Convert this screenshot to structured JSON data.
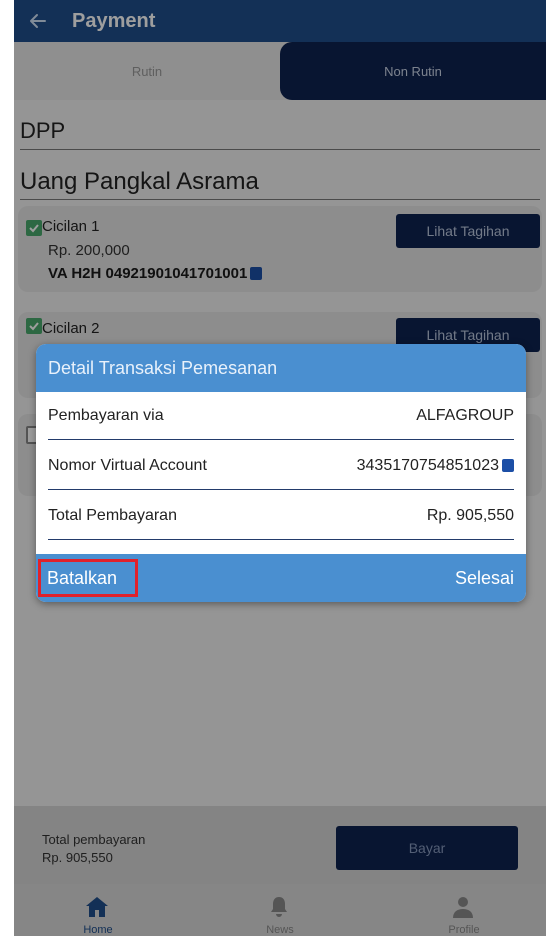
{
  "header": {
    "title": "Payment",
    "back_icon": "arrow-left-icon"
  },
  "tabs": [
    {
      "label": "Rutin",
      "active": false
    },
    {
      "label": "Non Rutin",
      "active": true
    }
  ],
  "sections": {
    "dpp": "DPP",
    "uang_pangkal": "Uang Pangkal Asrama"
  },
  "items": [
    {
      "label": "Cicilan 1",
      "amount": "Rp. 200,000",
      "va": "VA H2H 04921901041701001",
      "button": "Lihat Tagihan",
      "checked": true
    },
    {
      "label": "Cicilan 2",
      "button": "Lihat Tagihan",
      "checked": true
    }
  ],
  "dialog": {
    "title": "Detail Transaksi Pemesanan",
    "rows": [
      {
        "label": "Pembayaran via",
        "value": "ALFAGROUP"
      },
      {
        "label": "Nomor Virtual Account",
        "value": "3435170754851023"
      },
      {
        "label": "Total Pembayaran",
        "value": "Rp. 905,550"
      }
    ],
    "cancel": "Batalkan",
    "done": "Selesai"
  },
  "footer": {
    "total_label": "Total pembayaran",
    "total_value": "Rp. 905,550",
    "pay": "Bayar"
  },
  "nav": [
    {
      "label": "Home",
      "icon": "home-icon"
    },
    {
      "label": "News",
      "icon": "bell-icon"
    },
    {
      "label": "Profile",
      "icon": "user-icon"
    }
  ],
  "colors": {
    "primary": "#1f4e8c",
    "navy": "#0e2250",
    "dialog": "#4a8fd0",
    "highlight": "#e0212b",
    "check": "#4aa96c"
  }
}
